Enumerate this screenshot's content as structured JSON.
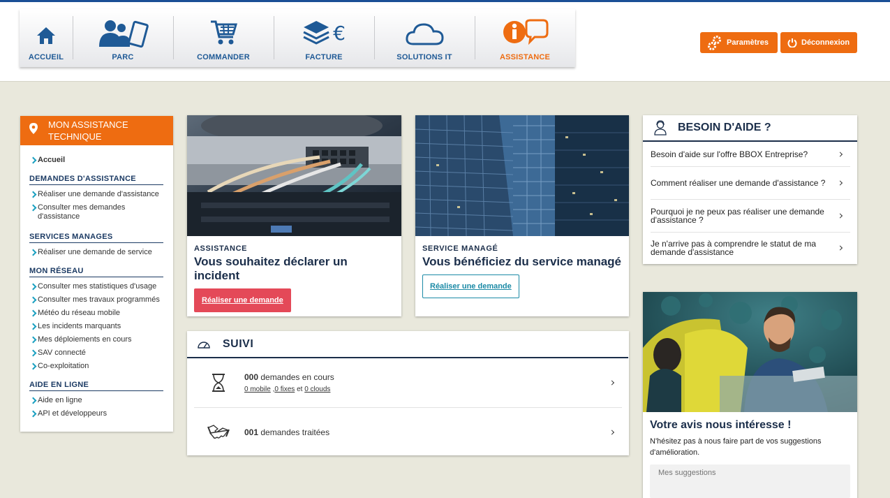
{
  "nav": {
    "items": [
      {
        "label": "ACCUEIL"
      },
      {
        "label": "PARC"
      },
      {
        "label": "COMMANDER"
      },
      {
        "label": "FACTURE"
      },
      {
        "label": "SOLUTIONS IT"
      },
      {
        "label": "ASSISTANCE"
      }
    ],
    "active": "ASSISTANCE",
    "facture_symbol": "€"
  },
  "header_buttons": {
    "settings": "Paramètres",
    "logout": "Déconnexion"
  },
  "sidebar": {
    "title": "MON ASSISTANCE TECHNIQUE",
    "home": "Accueil",
    "sections": [
      {
        "title": "DEMANDES D'ASSISTANCE",
        "links": [
          "Réaliser une demande d'assistance",
          "Consulter mes demandes d'assistance"
        ]
      },
      {
        "title": "SERVICES MANAGES",
        "links": [
          "Réaliser une demande de service"
        ]
      },
      {
        "title": "MON RÉSEAU",
        "links": [
          "Consulter mes statistiques d'usage",
          "Consulter mes travaux programmés",
          "Météo du réseau mobile",
          "Les incidents marquants",
          "Mes déploiements en cours",
          "SAV connecté",
          "Co-exploitation"
        ]
      },
      {
        "title": "AIDE EN LIGNE",
        "links": [
          "Aide en ligne",
          "API et développeurs"
        ]
      }
    ]
  },
  "card_incident": {
    "kicker": "ASSISTANCE",
    "title": "Vous souhaitez déclarer un incident",
    "button": "Réaliser une demande"
  },
  "card_service": {
    "kicker": "SERVICE MANAGÉ",
    "title": "Vous bénéficiez du service managé",
    "button": "Réaliser une demande"
  },
  "suivi": {
    "title": "SUIVI",
    "in_progress_count": "000",
    "in_progress_label": "demandes en cours",
    "mobile": "0 mobile",
    "fixes": "0 fixes",
    "et": "et",
    "clouds": "0 clouds",
    "done_count": "001",
    "done_label": "demandes traitées"
  },
  "help": {
    "title": "BESOIN D'AIDE ?",
    "items": [
      "Besoin d'aide sur l'offre BBOX Entreprise?",
      "Comment réaliser une demande d'assistance ?",
      "Pourquoi je ne peux pas réaliser une demande d'assistance ?",
      "Je n'arrive pas à comprendre le statut de ma demande d'assistance"
    ]
  },
  "avis": {
    "title": "Votre avis nous intéresse !",
    "text": "N'hésitez pas à nous faire part de vos suggestions d'amélioration.",
    "placeholder": "Mes suggestions"
  },
  "colors": {
    "brand_blue": "#1f5a96",
    "accent_orange": "#ee6c11",
    "navy": "#1b2e4a",
    "teal": "#1aa0c0",
    "red_button": "#e44958"
  }
}
